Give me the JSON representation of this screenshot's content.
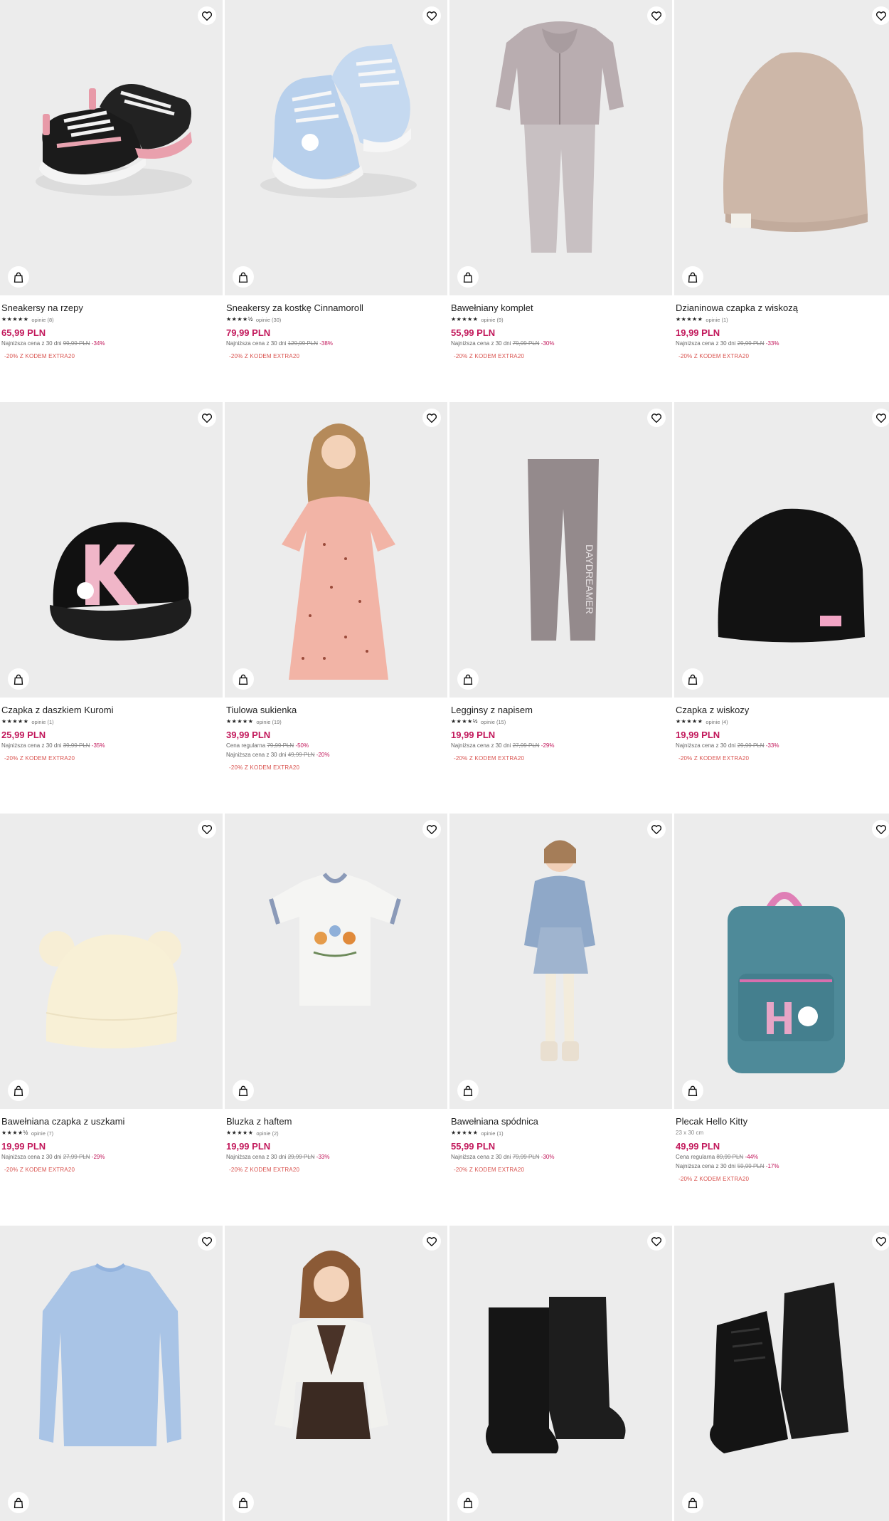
{
  "products": [
    {
      "name": "Sneakersy na rzepy",
      "stars": "★★★★★",
      "reviews": "opinie (8)",
      "price": "65,99 PLN",
      "notes": [
        {
          "label": "Najniższa cena z 30 dni",
          "old": "99,99 PLN",
          "pct": "-34%"
        }
      ],
      "promo": "-20% Z KODEM EXTRA20",
      "art": "sneakers-pink"
    },
    {
      "name": "Sneakersy za kostkę Cinnamoroll",
      "stars": "★★★★½",
      "reviews": "opinie (30)",
      "price": "79,99 PLN",
      "notes": [
        {
          "label": "Najniższa cena z 30 dni",
          "old": "129,99 PLN",
          "pct": "-38%"
        }
      ],
      "promo": "-20% Z KODEM EXTRA20",
      "art": "sneakers-blue"
    },
    {
      "name": "Bawełniany komplet",
      "stars": "★★★★★",
      "reviews": "opinie (9)",
      "price": "55,99 PLN",
      "notes": [
        {
          "label": "Najniższa cena z 30 dni",
          "old": "79,99 PLN",
          "pct": "-30%"
        }
      ],
      "promo": "-20% Z KODEM EXTRA20",
      "art": "tracksuit"
    },
    {
      "name": "Dzianinowa czapka z wiskozą",
      "stars": "★★★★★",
      "reviews": "opinie (1)",
      "price": "19,99 PLN",
      "notes": [
        {
          "label": "Najniższa cena z 30 dni",
          "old": "29,99 PLN",
          "pct": "-33%"
        }
      ],
      "promo": "-20% Z KODEM EXTRA20",
      "art": "beanie-beige"
    },
    {
      "name": "Czapka z daszkiem Kuromi",
      "stars": "★★★★★",
      "reviews": "opinie (1)",
      "price": "25,99 PLN",
      "notes": [
        {
          "label": "Najniższa cena z 30 dni",
          "old": "39,99 PLN",
          "pct": "-35%"
        }
      ],
      "promo": "-20% Z KODEM EXTRA20",
      "art": "cap"
    },
    {
      "name": "Tiulowa sukienka",
      "stars": "★★★★★",
      "reviews": "opinie (19)",
      "price": "39,99 PLN",
      "notes": [
        {
          "label": "Cena regularna",
          "old": "79,99 PLN",
          "pct": "-50%"
        },
        {
          "label": "Najniższa cena z 30 dni",
          "old": "49,99 PLN",
          "pct": "-20%"
        }
      ],
      "promo": "-20% Z KODEM EXTRA20",
      "art": "dress"
    },
    {
      "name": "Legginsy z napisem",
      "stars": "★★★★½",
      "reviews": "opinie (15)",
      "price": "19,99 PLN",
      "notes": [
        {
          "label": "Najniższa cena z 30 dni",
          "old": "27,99 PLN",
          "pct": "-29%"
        }
      ],
      "promo": "-20% Z KODEM EXTRA20",
      "art": "leggings"
    },
    {
      "name": "Czapka z wiskozy",
      "stars": "★★★★★",
      "reviews": "opinie (4)",
      "price": "19,99 PLN",
      "notes": [
        {
          "label": "Najniższa cena z 30 dni",
          "old": "29,99 PLN",
          "pct": "-33%"
        }
      ],
      "promo": "-20% Z KODEM EXTRA20",
      "art": "beanie-black"
    },
    {
      "name": "Bawełniana czapka z uszkami",
      "stars": "★★★★½",
      "reviews": "opinie (7)",
      "price": "19,99 PLN",
      "notes": [
        {
          "label": "Najniższa cena z 30 dni",
          "old": "27,99 PLN",
          "pct": "-29%"
        }
      ],
      "promo": "-20% Z KODEM EXTRA20",
      "art": "beanie-ears"
    },
    {
      "name": "Bluzka z haftem",
      "stars": "★★★★★",
      "reviews": "opinie (2)",
      "price": "19,99 PLN",
      "notes": [
        {
          "label": "Najniższa cena z 30 dni",
          "old": "29,99 PLN",
          "pct": "-33%"
        }
      ],
      "promo": "-20% Z KODEM EXTRA20",
      "art": "tshirt"
    },
    {
      "name": "Bawełniana spódnica",
      "stars": "★★★★★",
      "reviews": "opinie (1)",
      "price": "55,99 PLN",
      "notes": [
        {
          "label": "Najniższa cena z 30 dni",
          "old": "79,99 PLN",
          "pct": "-30%"
        }
      ],
      "promo": "-20% Z KODEM EXTRA20",
      "art": "girl-denim"
    },
    {
      "name": "Plecak Hello Kitty",
      "sub": "23 x 30 cm",
      "price": "49,99 PLN",
      "notes": [
        {
          "label": "Cena regularna",
          "old": "89,99 PLN",
          "pct": "-44%"
        },
        {
          "label": "Najniższa cena z 30 dni",
          "old": "59,99 PLN",
          "pct": "-17%"
        }
      ],
      "promo": "-20% Z KODEM EXTRA20",
      "art": "backpack"
    },
    {
      "name": "",
      "art": "sweater"
    },
    {
      "name": "",
      "art": "girl-cardigan"
    },
    {
      "name": "",
      "art": "boots-tall"
    },
    {
      "name": "",
      "art": "boots-lace"
    }
  ],
  "icons": {
    "favorite": "heart-icon",
    "cart": "shopping-bag-icon"
  },
  "colors": {
    "price": "#c2185b",
    "promo": "#d9534f",
    "image_bg": "#ececec"
  }
}
